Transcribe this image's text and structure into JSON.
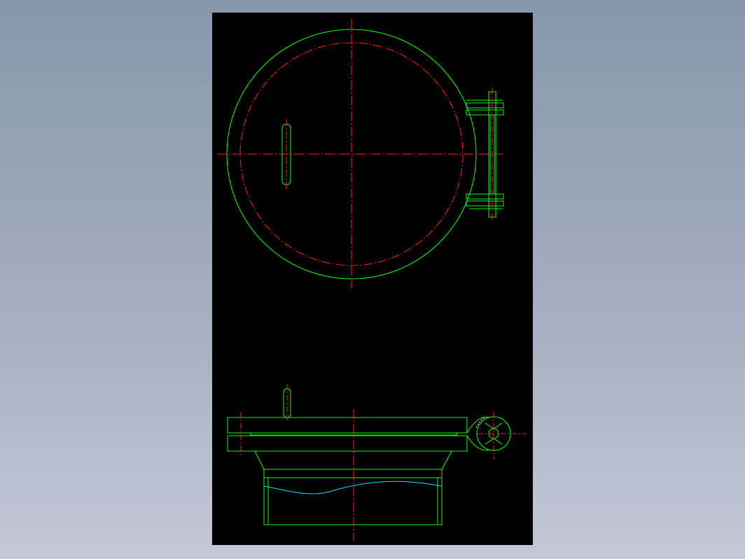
{
  "drawing": {
    "title": "",
    "views": [
      "top-view",
      "front-view"
    ]
  },
  "colors": {
    "background": "#000000",
    "outline": "#00ff00",
    "centerline": "#ff2020",
    "breakline": "#00e5ff",
    "outer_background_top": "#8797ab",
    "outer_background_bottom": "#c3c8d6"
  },
  "line_styles": {
    "visible": "solid",
    "center": "dash-dot",
    "break": "wavy"
  }
}
